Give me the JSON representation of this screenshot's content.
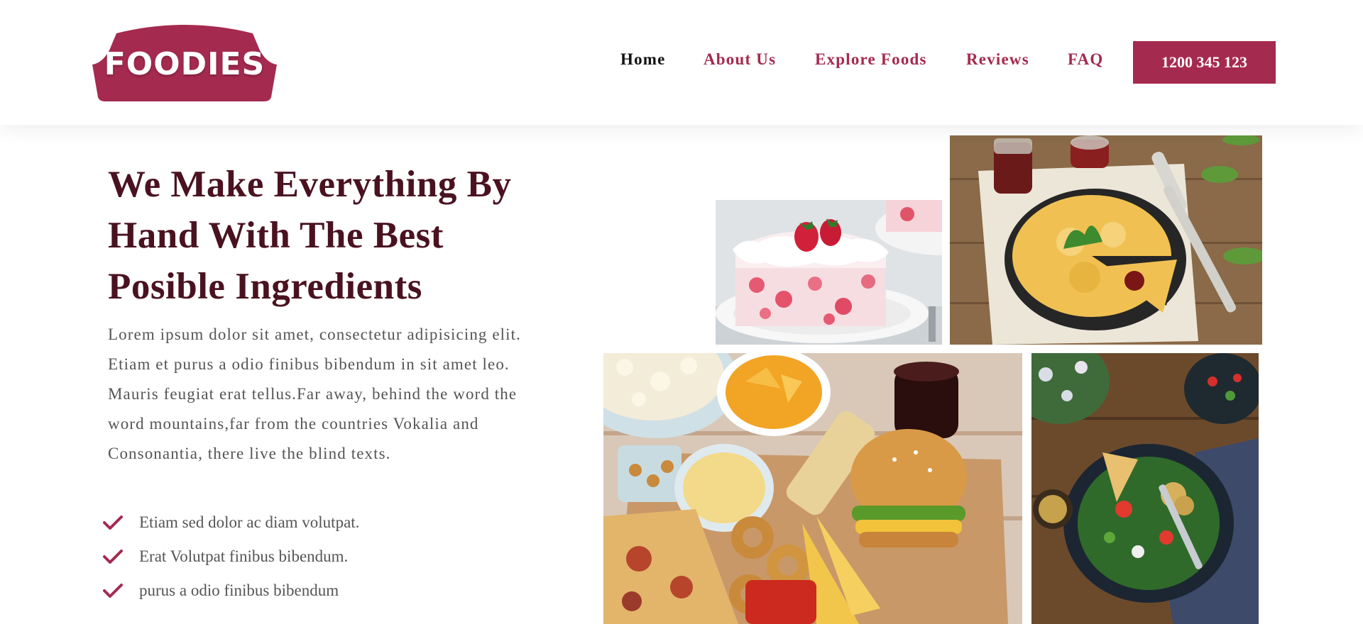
{
  "brand": {
    "name": "FOODIES",
    "color": "#a52a50",
    "heading_color": "#4a1220"
  },
  "nav": {
    "items": [
      {
        "label": "Home",
        "active": true
      },
      {
        "label": "About Us",
        "active": false
      },
      {
        "label": "Explore Foods",
        "active": false
      },
      {
        "label": "Reviews",
        "active": false
      },
      {
        "label": "FAQ",
        "active": false
      }
    ],
    "phone_button": "1200 345 123"
  },
  "hero": {
    "title_lines": [
      "We Make Everything By",
      "Hand With The Best",
      "Posible Ingredients"
    ],
    "description_lines": [
      "Lorem ipsum dolor sit amet, consectetur adipisicing elit.",
      "Etiam et purus a odio finibus bibendum in sit amet leo.",
      "Mauris feugiat erat tellus.Far away, behind the word the",
      "word mountains,far from the countries Vokalia and",
      "Consonantia, there live the blind texts."
    ],
    "features": [
      {
        "icon": "check-icon",
        "text": "Etiam sed dolor ac diam volutpat."
      },
      {
        "icon": "check-icon",
        "text": "Erat Volutpat finibus bibendum."
      },
      {
        "icon": "check-icon",
        "text": "purus a odio finibus bibendum"
      }
    ]
  },
  "gallery": [
    {
      "subject": "strawberry-cake-photo"
    },
    {
      "subject": "cheese-pie-photo"
    },
    {
      "subject": "fast-food-platter-photo"
    },
    {
      "subject": "salad-bowl-photo"
    }
  ]
}
